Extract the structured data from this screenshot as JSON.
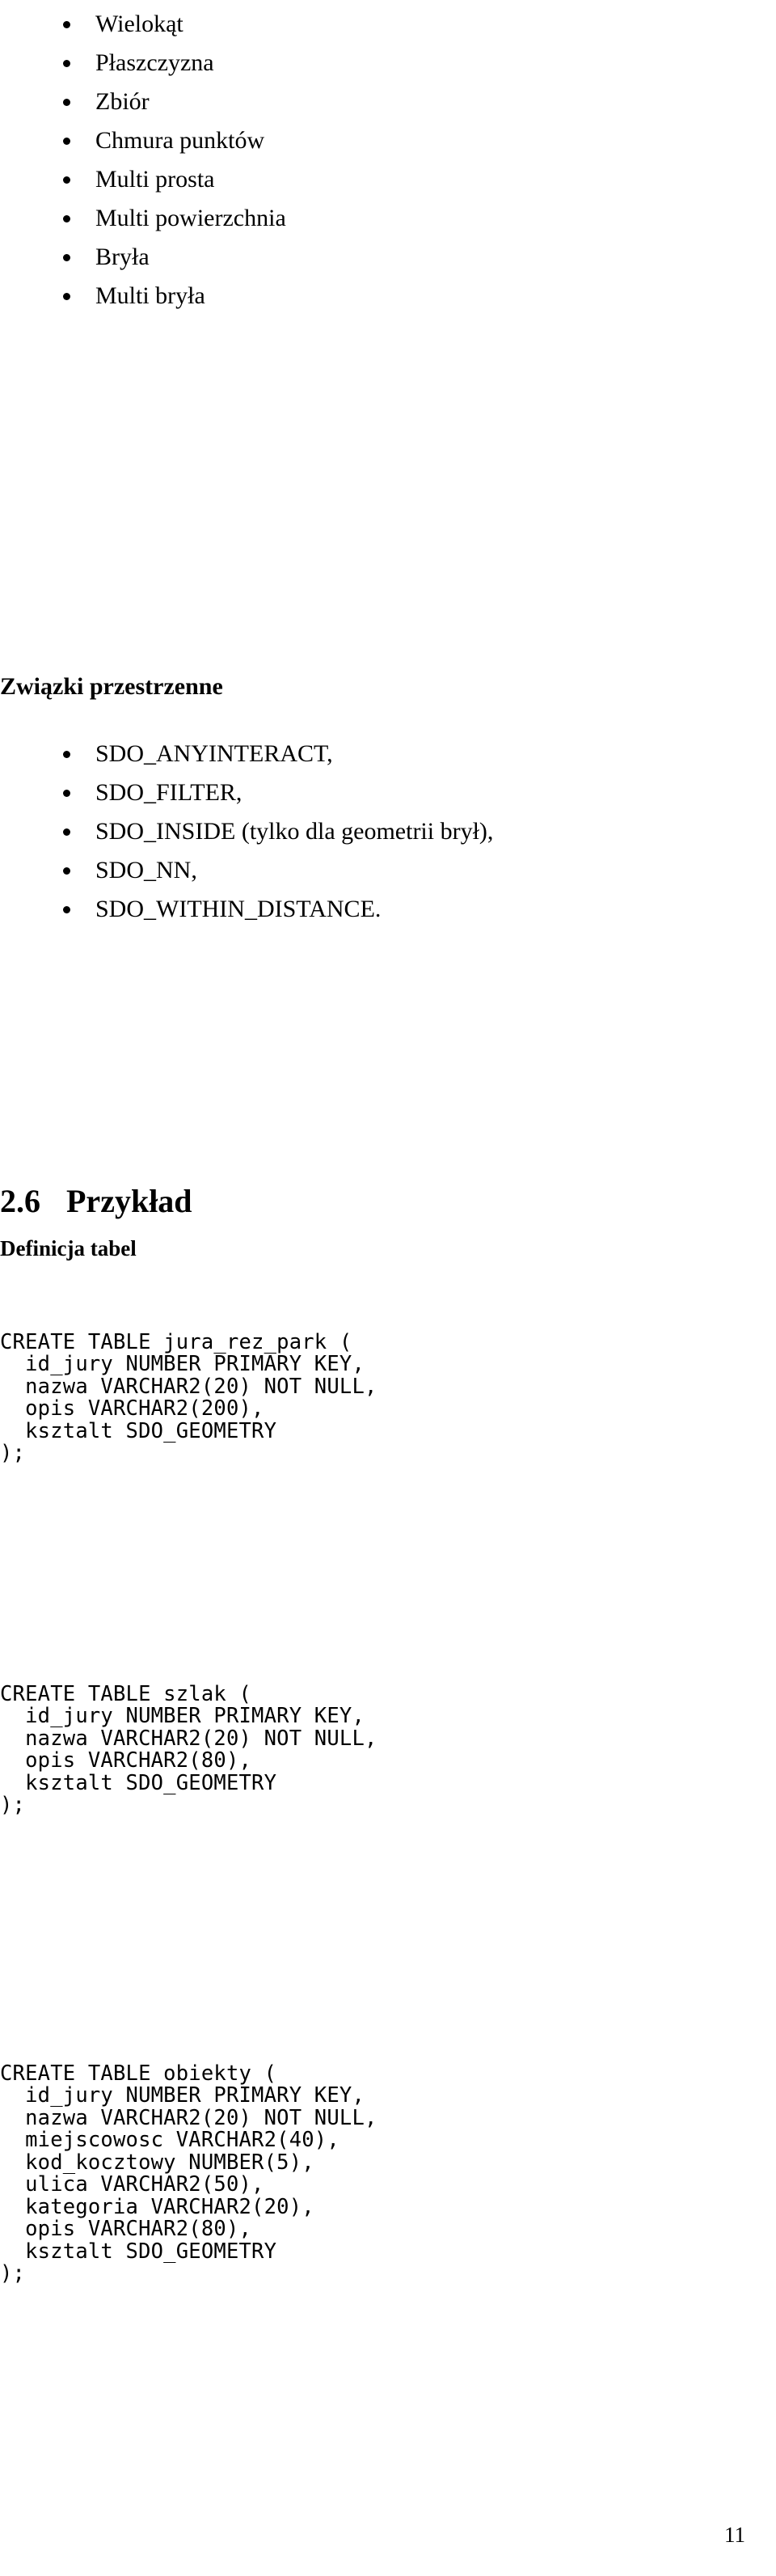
{
  "page": {
    "number": "11",
    "language": "pl",
    "background_color": "#ffffff",
    "text_color": "#000000"
  },
  "geometry_types_list": {
    "items": [
      {
        "label": "Wielokąt"
      },
      {
        "label": "Płaszczyzna"
      },
      {
        "label": "Zbiór"
      },
      {
        "label": "Chmura punktów"
      },
      {
        "label": "Multi prosta"
      },
      {
        "label": "Multi powierzchnia"
      },
      {
        "label": "Bryła"
      },
      {
        "label": "Multi bryła"
      }
    ]
  },
  "relations_section": {
    "heading": "Związki przestrzenne",
    "items": [
      {
        "label": "SDO_ANYINTERACT,"
      },
      {
        "label": "SDO_FILTER,"
      },
      {
        "label": "SDO_INSIDE (tylko dla geometrii brył),"
      },
      {
        "label": "SDO_NN,"
      },
      {
        "label": "SDO_WITHIN_DISTANCE."
      }
    ]
  },
  "example_section": {
    "number": "2.6",
    "title": "Przykład",
    "subheading": "Definicja tabel",
    "code_blocks": [
      {
        "name": "jura_rez_park",
        "lines": [
          "CREATE TABLE jura_rez_park (",
          "  id_jury NUMBER PRIMARY KEY,",
          "  nazwa VARCHAR2(20) NOT NULL,",
          "  opis VARCHAR2(200),",
          "  ksztalt SDO_GEOMETRY",
          ");"
        ]
      },
      {
        "name": "szlak",
        "lines": [
          "CREATE TABLE szlak (",
          "  id_jury NUMBER PRIMARY KEY,",
          "  nazwa VARCHAR2(20) NOT NULL,",
          "  opis VARCHAR2(80),",
          "  ksztalt SDO_GEOMETRY",
          ");"
        ]
      },
      {
        "name": "obiekty",
        "lines": [
          "CREATE TABLE obiekty (",
          "  id_jury NUMBER PRIMARY KEY,",
          "  nazwa VARCHAR2(20) NOT NULL,",
          "  miejscowosc VARCHAR2(40),",
          "  kod_kocztowy NUMBER(5),",
          "  ulica VARCHAR2(50),",
          "  kategoria VARCHAR2(20),",
          "  opis VARCHAR2(80),",
          "  ksztalt SDO_GEOMETRY",
          ");"
        ]
      }
    ]
  }
}
